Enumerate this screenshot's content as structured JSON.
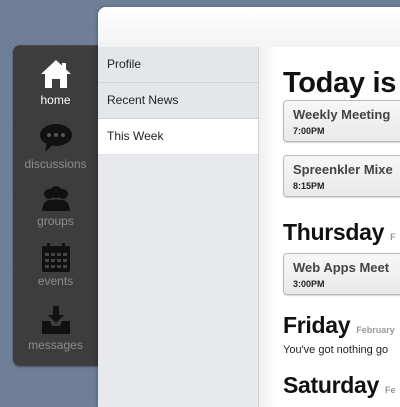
{
  "dock": {
    "items": [
      {
        "label": "home",
        "icon": "home-icon"
      },
      {
        "label": "discussions",
        "icon": "speech-bubble-icon"
      },
      {
        "label": "groups",
        "icon": "people-icon"
      },
      {
        "label": "events",
        "icon": "calendar-icon"
      },
      {
        "label": "messages",
        "icon": "inbox-icon"
      }
    ],
    "active": "home"
  },
  "sidebar": {
    "items": [
      {
        "label": "Profile"
      },
      {
        "label": "Recent News"
      },
      {
        "label": "This Week"
      }
    ],
    "active": "This Week"
  },
  "content": {
    "today_heading": "Today is",
    "today_events": [
      {
        "title": "Weekly Meeting",
        "time": "7:00PM"
      },
      {
        "title": "Spreenkler Mixe",
        "time": "8:15PM"
      }
    ],
    "thursday": {
      "day": "Thursday",
      "date": "F"
    },
    "thursday_events": [
      {
        "title": "Web Apps Meet",
        "time": "3:00PM"
      }
    ],
    "friday": {
      "day": "Friday",
      "date": "February"
    },
    "friday_note": "You've got nothing go",
    "saturday": {
      "day": "Saturday",
      "date": "Fe"
    }
  },
  "colors": {
    "background": "#6c7d95",
    "dock": "#3d3d3d",
    "sidebar": "#e7e9ec"
  }
}
